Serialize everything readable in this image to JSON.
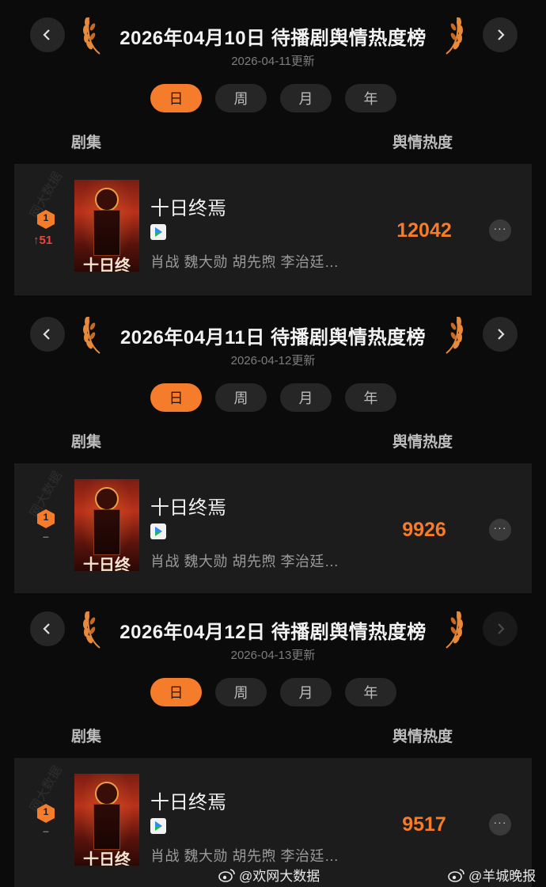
{
  "sections": [
    {
      "title": "2026年04月10日 待播剧舆情热度榜",
      "updated": "2026-04-11更新",
      "tabs": [
        "日",
        "周",
        "月",
        "年"
      ],
      "active_tab": "日",
      "col_left": "剧集",
      "col_right": "舆情热度",
      "next_enabled": true,
      "entry": {
        "rank": "1",
        "rank_change": "↑51",
        "show_title": "十日终焉",
        "poster_text": "十日终焉",
        "cast": "肖战 魏大勋 胡先煦 李治廷…",
        "score": "12042",
        "more_label": "···"
      }
    },
    {
      "title": "2026年04月11日 待播剧舆情热度榜",
      "updated": "2026-04-12更新",
      "tabs": [
        "日",
        "周",
        "月",
        "年"
      ],
      "active_tab": "日",
      "col_left": "剧集",
      "col_right": "舆情热度",
      "next_enabled": true,
      "entry": {
        "rank": "1",
        "rank_change": "–",
        "show_title": "十日终焉",
        "poster_text": "十日终焉",
        "cast": "肖战 魏大勋 胡先煦 李治廷…",
        "score": "9926",
        "more_label": "···"
      }
    },
    {
      "title": "2026年04月12日 待播剧舆情热度榜",
      "updated": "2026-04-13更新",
      "tabs": [
        "日",
        "周",
        "月",
        "年"
      ],
      "active_tab": "日",
      "col_left": "剧集",
      "col_right": "舆情热度",
      "next_enabled": false,
      "entry": {
        "rank": "1",
        "rank_change": "–",
        "show_title": "十日终焉",
        "poster_text": "十日终焉",
        "cast": "肖战 魏大勋 胡先煦 李治廷…",
        "score": "9517",
        "more_label": "···"
      }
    }
  ],
  "watermark": "网大数据",
  "credits": [
    "@欢网大数据",
    "@羊城晚报"
  ],
  "colors": {
    "accent": "#f47c2a",
    "up": "#e9473b",
    "background": "#0b0b0b",
    "card": "#1c1c1c"
  }
}
